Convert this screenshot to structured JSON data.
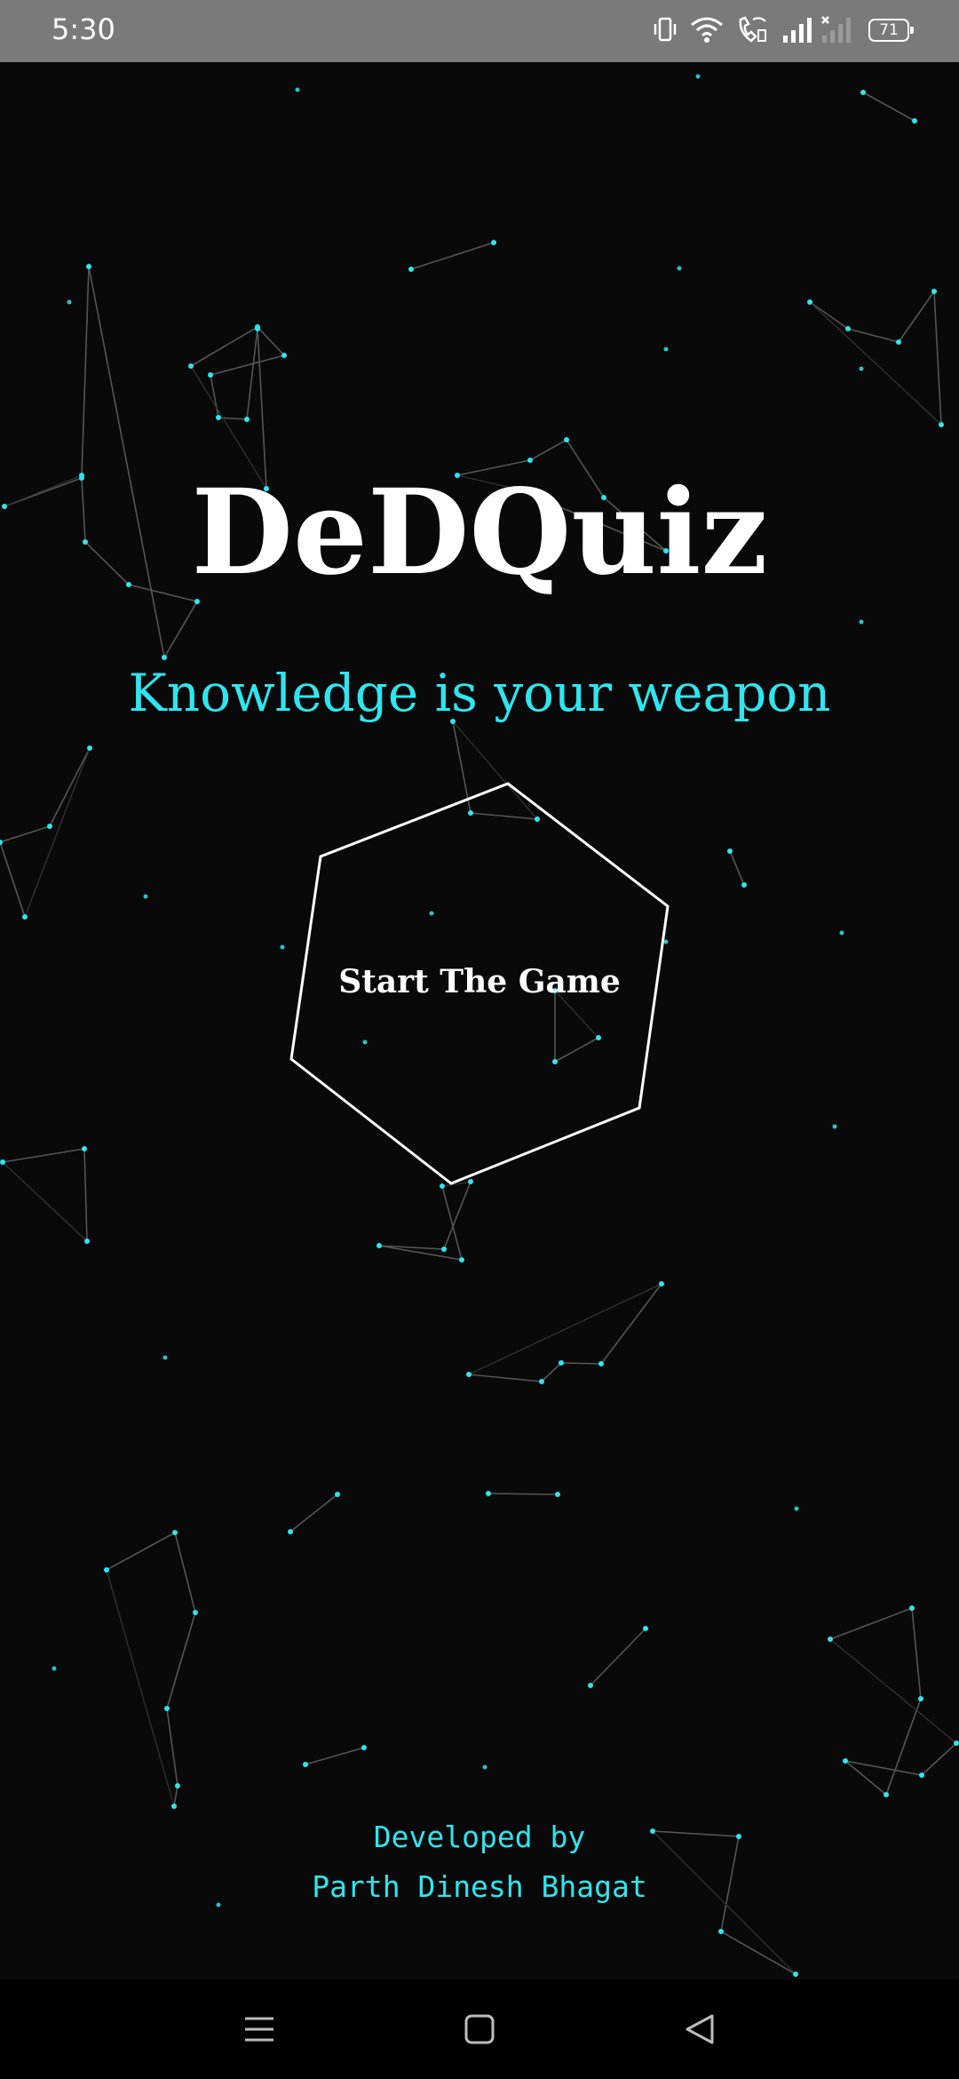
{
  "status_bar": {
    "time": "5:30",
    "battery_level": "71",
    "icons": [
      "vibrate-icon",
      "wifi-icon",
      "wifi-call-icon",
      "signal-icon",
      "signal-no-service-icon",
      "battery-icon"
    ]
  },
  "app": {
    "title": "DeDQuiz",
    "tagline": "Knowledge is your weapon",
    "start_button_label": "Start The Game"
  },
  "credits": {
    "line1": "Developed by",
    "line2": "Parth Dinesh Bhagat"
  },
  "nav_bar": {
    "icons": [
      "recents-menu-icon",
      "home-square-icon",
      "back-triangle-icon"
    ]
  },
  "colors": {
    "background": "#090909",
    "accent": "#2ee6ef",
    "title": "#ffffff",
    "status_bar": "#7a7a7a",
    "particle_line": "#555555"
  }
}
